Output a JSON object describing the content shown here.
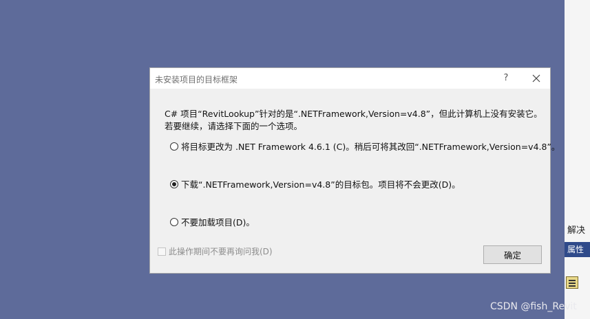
{
  "dialog": {
    "title": "未安装项目的目标框架",
    "help_label": "?",
    "message": "C# 项目“RevitLookup”针对的是“.NETFramework,Version=v4.8”，但此计算机上没有安装它。 若要继续，请选择下面的一个选项。",
    "options": [
      {
        "label": "将目标更改为 .NET Framework 4.6.1 (C)。稍后可将其改回“.NETFramework,Version=v4.8”。",
        "selected": false
      },
      {
        "label": "下载“.NETFramework,Version=v4.8”的目标包。项目将不会更改(D)。",
        "selected": true
      },
      {
        "label": "不要加载项目(D)。",
        "selected": false
      }
    ],
    "dont_ask_label": "此操作期间不要再询问我(D)",
    "ok_label": "确定"
  },
  "side_panel": {
    "label": "解决",
    "props_label": "属性"
  },
  "watermark": "CSDN @fish_Revit",
  "colors": {
    "desktop_bg": "#5e6b9a",
    "dialog_bg": "#f0f0f0",
    "props_header": "#2f4a8a"
  }
}
